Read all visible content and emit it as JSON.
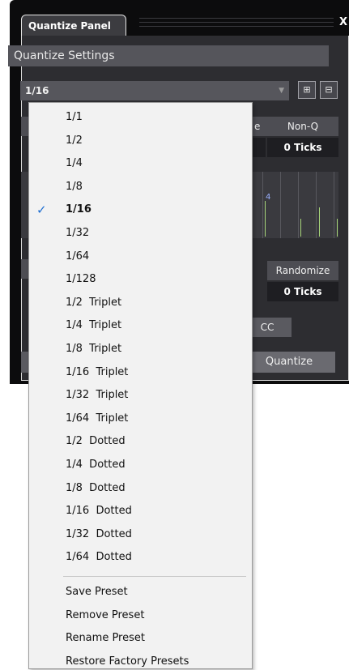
{
  "window": {
    "tab_title": "Quantize Panel",
    "close_label": "X"
  },
  "settings": {
    "title": "Quantize Settings",
    "preset_value": "1/16",
    "columns": {
      "col_e_label": "e",
      "non_q_label": "Non-Q",
      "non_q_value": "0 Ticks",
      "randomize_label": "Randomize",
      "randomize_value": "0 Ticks"
    },
    "grid_label": "4",
    "cc_label": "CC",
    "quantize_label": "Quantize"
  },
  "menu": {
    "items": [
      "1/1",
      "1/2",
      "1/4",
      "1/8",
      "1/16",
      "1/32",
      "1/64",
      "1/128",
      "1/2  Triplet",
      "1/4  Triplet",
      "1/8  Triplet",
      "1/16  Triplet",
      "1/32  Triplet",
      "1/64  Triplet",
      "1/2  Dotted",
      "1/4  Dotted",
      "1/8  Dotted",
      "1/16  Dotted",
      "1/32  Dotted",
      "1/64  Dotted"
    ],
    "checked_index": 4,
    "actions": [
      "Save Preset",
      "Remove Preset",
      "Rename Preset",
      "Restore Factory Presets"
    ]
  },
  "colors": {
    "accent_check": "#1f6fd1",
    "grid_green": "#a8d67a"
  }
}
